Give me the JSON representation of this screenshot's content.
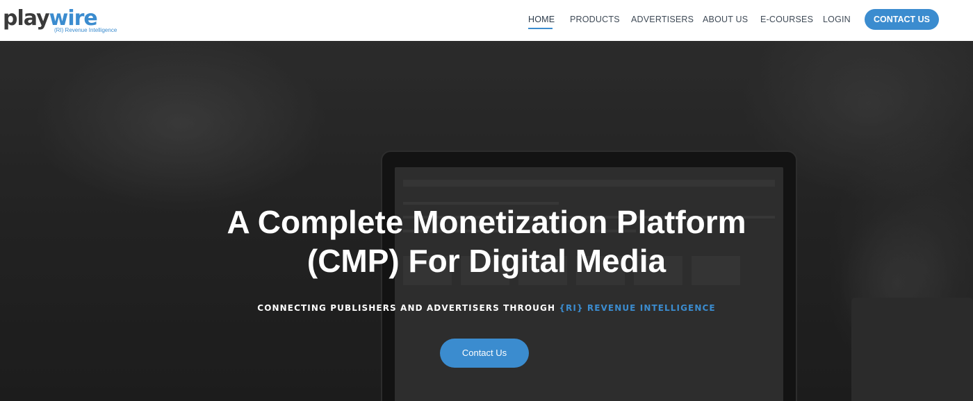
{
  "brand": {
    "logo_part1": "play",
    "logo_part2": "wire",
    "tagline": "(RI) Revenue Intelligence",
    "accent_color": "#3b8ccf"
  },
  "nav": {
    "items": [
      {
        "label": "HOME",
        "active": true
      },
      {
        "label": "PRODUCTS"
      },
      {
        "label": "ADVERTISERS"
      },
      {
        "label": "ABOUT US"
      },
      {
        "label": "E-COURSES"
      },
      {
        "label": "LOGIN"
      }
    ],
    "cta_label": "CONTACT US"
  },
  "hero": {
    "headline_line1": "A Complete Monetization Platform",
    "headline_line2": "(CMP) For Digital Media",
    "subline_main": "CONNECTING PUBLISHERS AND ADVERTISERS THROUGH ",
    "subline_accent": "{RI} REVENUE INTELLIGENCE",
    "button_label": "Contact Us"
  }
}
